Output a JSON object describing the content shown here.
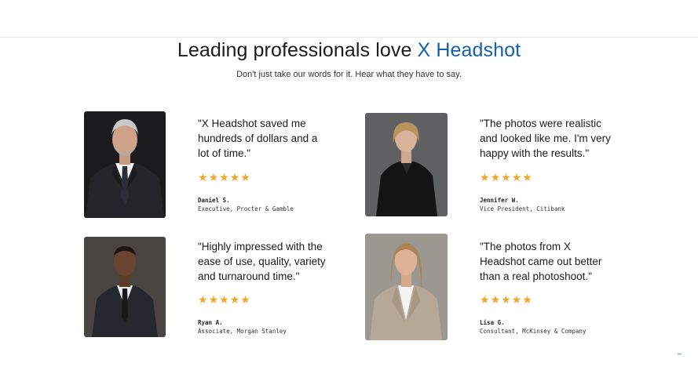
{
  "header": {
    "title_prefix": "Leading professionals love ",
    "title_brand": "X Headshot",
    "subtitle": "Don't just take our words for it. Hear what they have to say."
  },
  "colors": {
    "brand": "#1560a8",
    "star": "#f1a72c"
  },
  "testimonials": [
    {
      "quote_lines": [
        "\"X Headshot saved me",
        "hundreds of dollars and a",
        "lot of time.\""
      ],
      "rating": 5,
      "name": "Daniel S.",
      "role": "Executive, Procter & Gamble"
    },
    {
      "quote_lines": [
        "\"The photos were realistic",
        "and looked like me. I'm very",
        "happy with the results.\""
      ],
      "rating": 5,
      "name": "Jennifer W.",
      "role": "Vice President, Citibank"
    },
    {
      "quote_lines": [
        "\"Highly impressed with the",
        "ease of use, quality, variety",
        "and turnaround time.\""
      ],
      "rating": 5,
      "name": "Ryan A.",
      "role": "Associate, Morgan Stanley"
    },
    {
      "quote_lines": [
        "\"The photos from X",
        "Headshot came out better",
        "than a real photoshoot.\""
      ],
      "rating": 5,
      "name": "Lisa G.",
      "role": "Consultant, McKinsey & Company"
    }
  ],
  "icons": {
    "star": "star-icon"
  }
}
